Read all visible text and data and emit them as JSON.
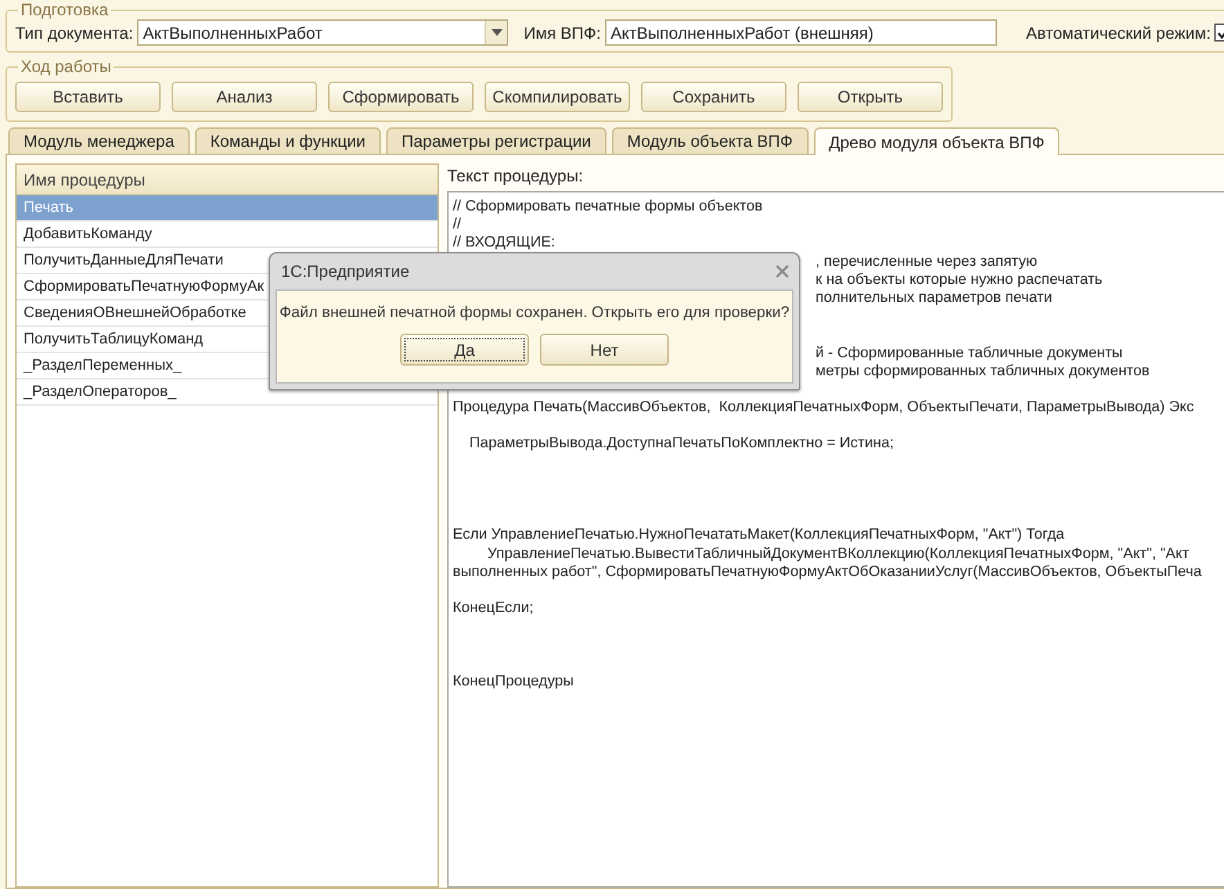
{
  "preparation": {
    "title": "Подготовка",
    "document_type": {
      "label": "Тип документа:",
      "value": "АктВыполненныхРабот"
    },
    "vpf_name": {
      "label": "Имя ВПФ:",
      "value": "АктВыполненныхРабот (внешняя)"
    },
    "auto_mode": {
      "label": "Автоматический режим:",
      "checked": true
    }
  },
  "workflow": {
    "title": "Ход работы",
    "buttons": [
      "Вставить",
      "Анализ",
      "Сформировать",
      "Скомпилировать",
      "Сохранить",
      "Открыть"
    ]
  },
  "tabs": [
    {
      "label": "Модуль менеджера",
      "selected": false
    },
    {
      "label": "Команды и функции",
      "selected": false
    },
    {
      "label": "Параметры регистрации",
      "selected": false
    },
    {
      "label": "Модуль объекта ВПФ",
      "selected": false
    },
    {
      "label": "Древо модуля объекта  ВПФ",
      "selected": true
    }
  ],
  "procedures": {
    "header": "Имя процедуры",
    "items": [
      {
        "name": "Печать",
        "selected": true
      },
      {
        "name": "ДобавитьКоманду",
        "selected": false
      },
      {
        "name": "ПолучитьДанныеДляПечати",
        "selected": false
      },
      {
        "name": "СформироватьПечатнуюФормуАк",
        "selected": false
      },
      {
        "name": "СведенияОВнешнейОбработке",
        "selected": false
      },
      {
        "name": "ПолучитьТаблицуКоманд",
        "selected": false
      },
      {
        "name": "_РазделПеременных_",
        "selected": false
      },
      {
        "name": "_РазделОператоров_",
        "selected": false
      }
    ]
  },
  "procedure_text": {
    "label": "Текст процедуры:",
    "lines": [
      {
        "kind": "line",
        "text": "// Сформировать печатные формы объектов"
      },
      {
        "kind": "line",
        "text": "//"
      },
      {
        "kind": "line",
        "text": "// ВХОДЯЩИЕ:"
      },
      {
        "kind": "partial",
        "text": ", перечисленные через запятую"
      },
      {
        "kind": "partial",
        "text": "к на объекты которые нужно распечатать"
      },
      {
        "kind": "partial",
        "text": "полнительных параметров печати"
      },
      {
        "kind": "blank"
      },
      {
        "kind": "blank"
      },
      {
        "kind": "partial",
        "text": "й - Сформированные табличные документы"
      },
      {
        "kind": "partial",
        "text": "метры сформированных табличных документов"
      },
      {
        "kind": "blank"
      },
      {
        "kind": "line",
        "text": "Процедура Печать(МассивОбъектов,  КоллекцияПечатныхФорм, ОбъектыПечати, ПараметрыВывода) Экс"
      },
      {
        "kind": "blank"
      },
      {
        "kind": "indent",
        "text": "ПараметрыВывода.ДоступнаПечатьПоКомплектно = Истина;"
      },
      {
        "kind": "blank"
      },
      {
        "kind": "blank"
      },
      {
        "kind": "blank"
      },
      {
        "kind": "blank"
      },
      {
        "kind": "line",
        "text": "Если УправлениеПечатью.НужноПечататьМакет(КоллекцияПечатныхФорм, \"Акт\") Тогда"
      },
      {
        "kind": "indent2",
        "text": "УправлениеПечатью.ВывестиТабличныйДокументВКоллекцию(КоллекцияПечатныхФорм, \"Акт\", \"Акт"
      },
      {
        "kind": "line",
        "text": "выполненных работ\", СформироватьПечатнуюФормуАктОбОказанииУслуг(МассивОбъектов, ОбъектыПеча"
      },
      {
        "kind": "blank"
      },
      {
        "kind": "line",
        "text": "КонецЕсли;"
      },
      {
        "kind": "blank"
      },
      {
        "kind": "blank"
      },
      {
        "kind": "blank"
      },
      {
        "kind": "line",
        "text": "КонецПроцедуры"
      }
    ]
  },
  "dialog": {
    "title": "1С:Предприятие",
    "message": "Файл внешней печатной формы сохранен. Открыть его для проверки?",
    "buttons": [
      {
        "label": "Да",
        "focused": true
      },
      {
        "label": "Нет",
        "focused": false
      }
    ]
  }
}
